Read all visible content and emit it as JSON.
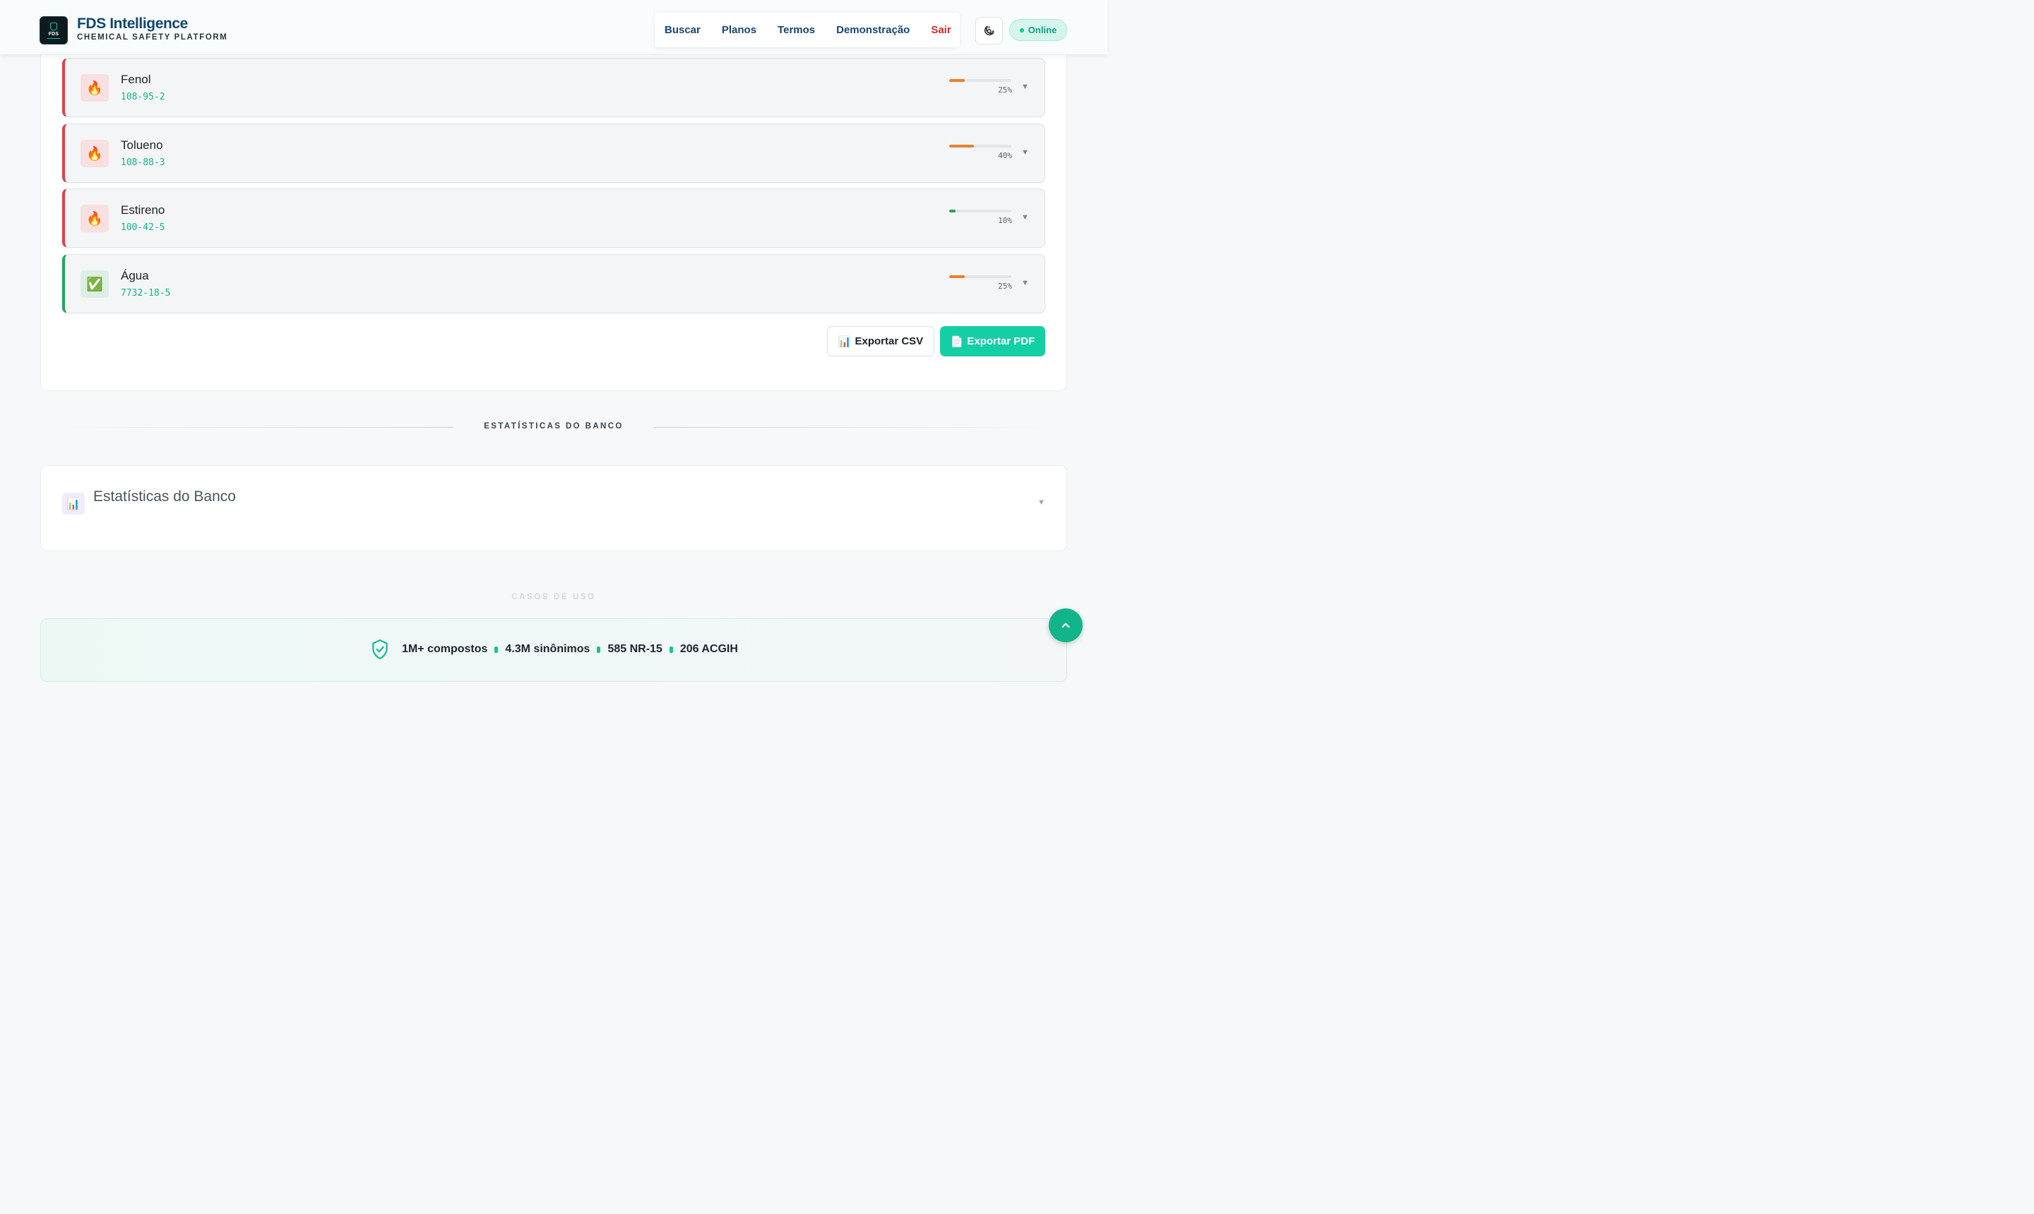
{
  "brand": {
    "logo_text": "FDS",
    "title": "FDS Intelligence",
    "subtitle": "CHEMICAL SAFETY PLATFORM"
  },
  "nav": {
    "items": [
      "Buscar",
      "Planos",
      "Termos",
      "Demonstração"
    ],
    "logout": "Sair"
  },
  "status": {
    "label": "Online"
  },
  "results": [
    {
      "name": "Fenol",
      "cas": "108-95-2",
      "icon": "🔥",
      "icon_name": "fire-icon",
      "percent": 25,
      "percent_label": "25%",
      "bar_color": "#e8802c",
      "status": "hazard"
    },
    {
      "name": "Tolueno",
      "cas": "108-88-3",
      "icon": "🔥",
      "icon_name": "fire-icon",
      "percent": 40,
      "percent_label": "40%",
      "bar_color": "#e8802c",
      "status": "hazard"
    },
    {
      "name": "Estireno",
      "cas": "100-42-5",
      "icon": "🔥",
      "icon_name": "fire-icon",
      "percent": 10,
      "percent_label": "10%",
      "bar_color": "#22a55a",
      "status": "hazard"
    },
    {
      "name": "Água",
      "cas": "7732-18-5",
      "icon": "✅",
      "icon_name": "check-icon",
      "percent": 25,
      "percent_label": "25%",
      "bar_color": "#e8802c",
      "status": "safe"
    }
  ],
  "export": {
    "csv_icon": "📊",
    "csv_label": "Exportar CSV",
    "pdf_icon": "📄",
    "pdf_label": "Exportar PDF"
  },
  "sections": {
    "stats_heading": "ESTATÍSTICAS DO BANCO",
    "stats_card_title": "Estatísticas do Banco",
    "stats_icon": "📊",
    "usecases_heading": "CASOS DE USO"
  },
  "banner": {
    "items": [
      "1M+ compostos",
      "4.3M sinônimos",
      "585 NR-15",
      "206 ACGIH"
    ]
  },
  "colors": {
    "accent": "#14cfa6",
    "brand": "#12466e",
    "danger": "#e0404a",
    "safe": "#22a55a"
  }
}
